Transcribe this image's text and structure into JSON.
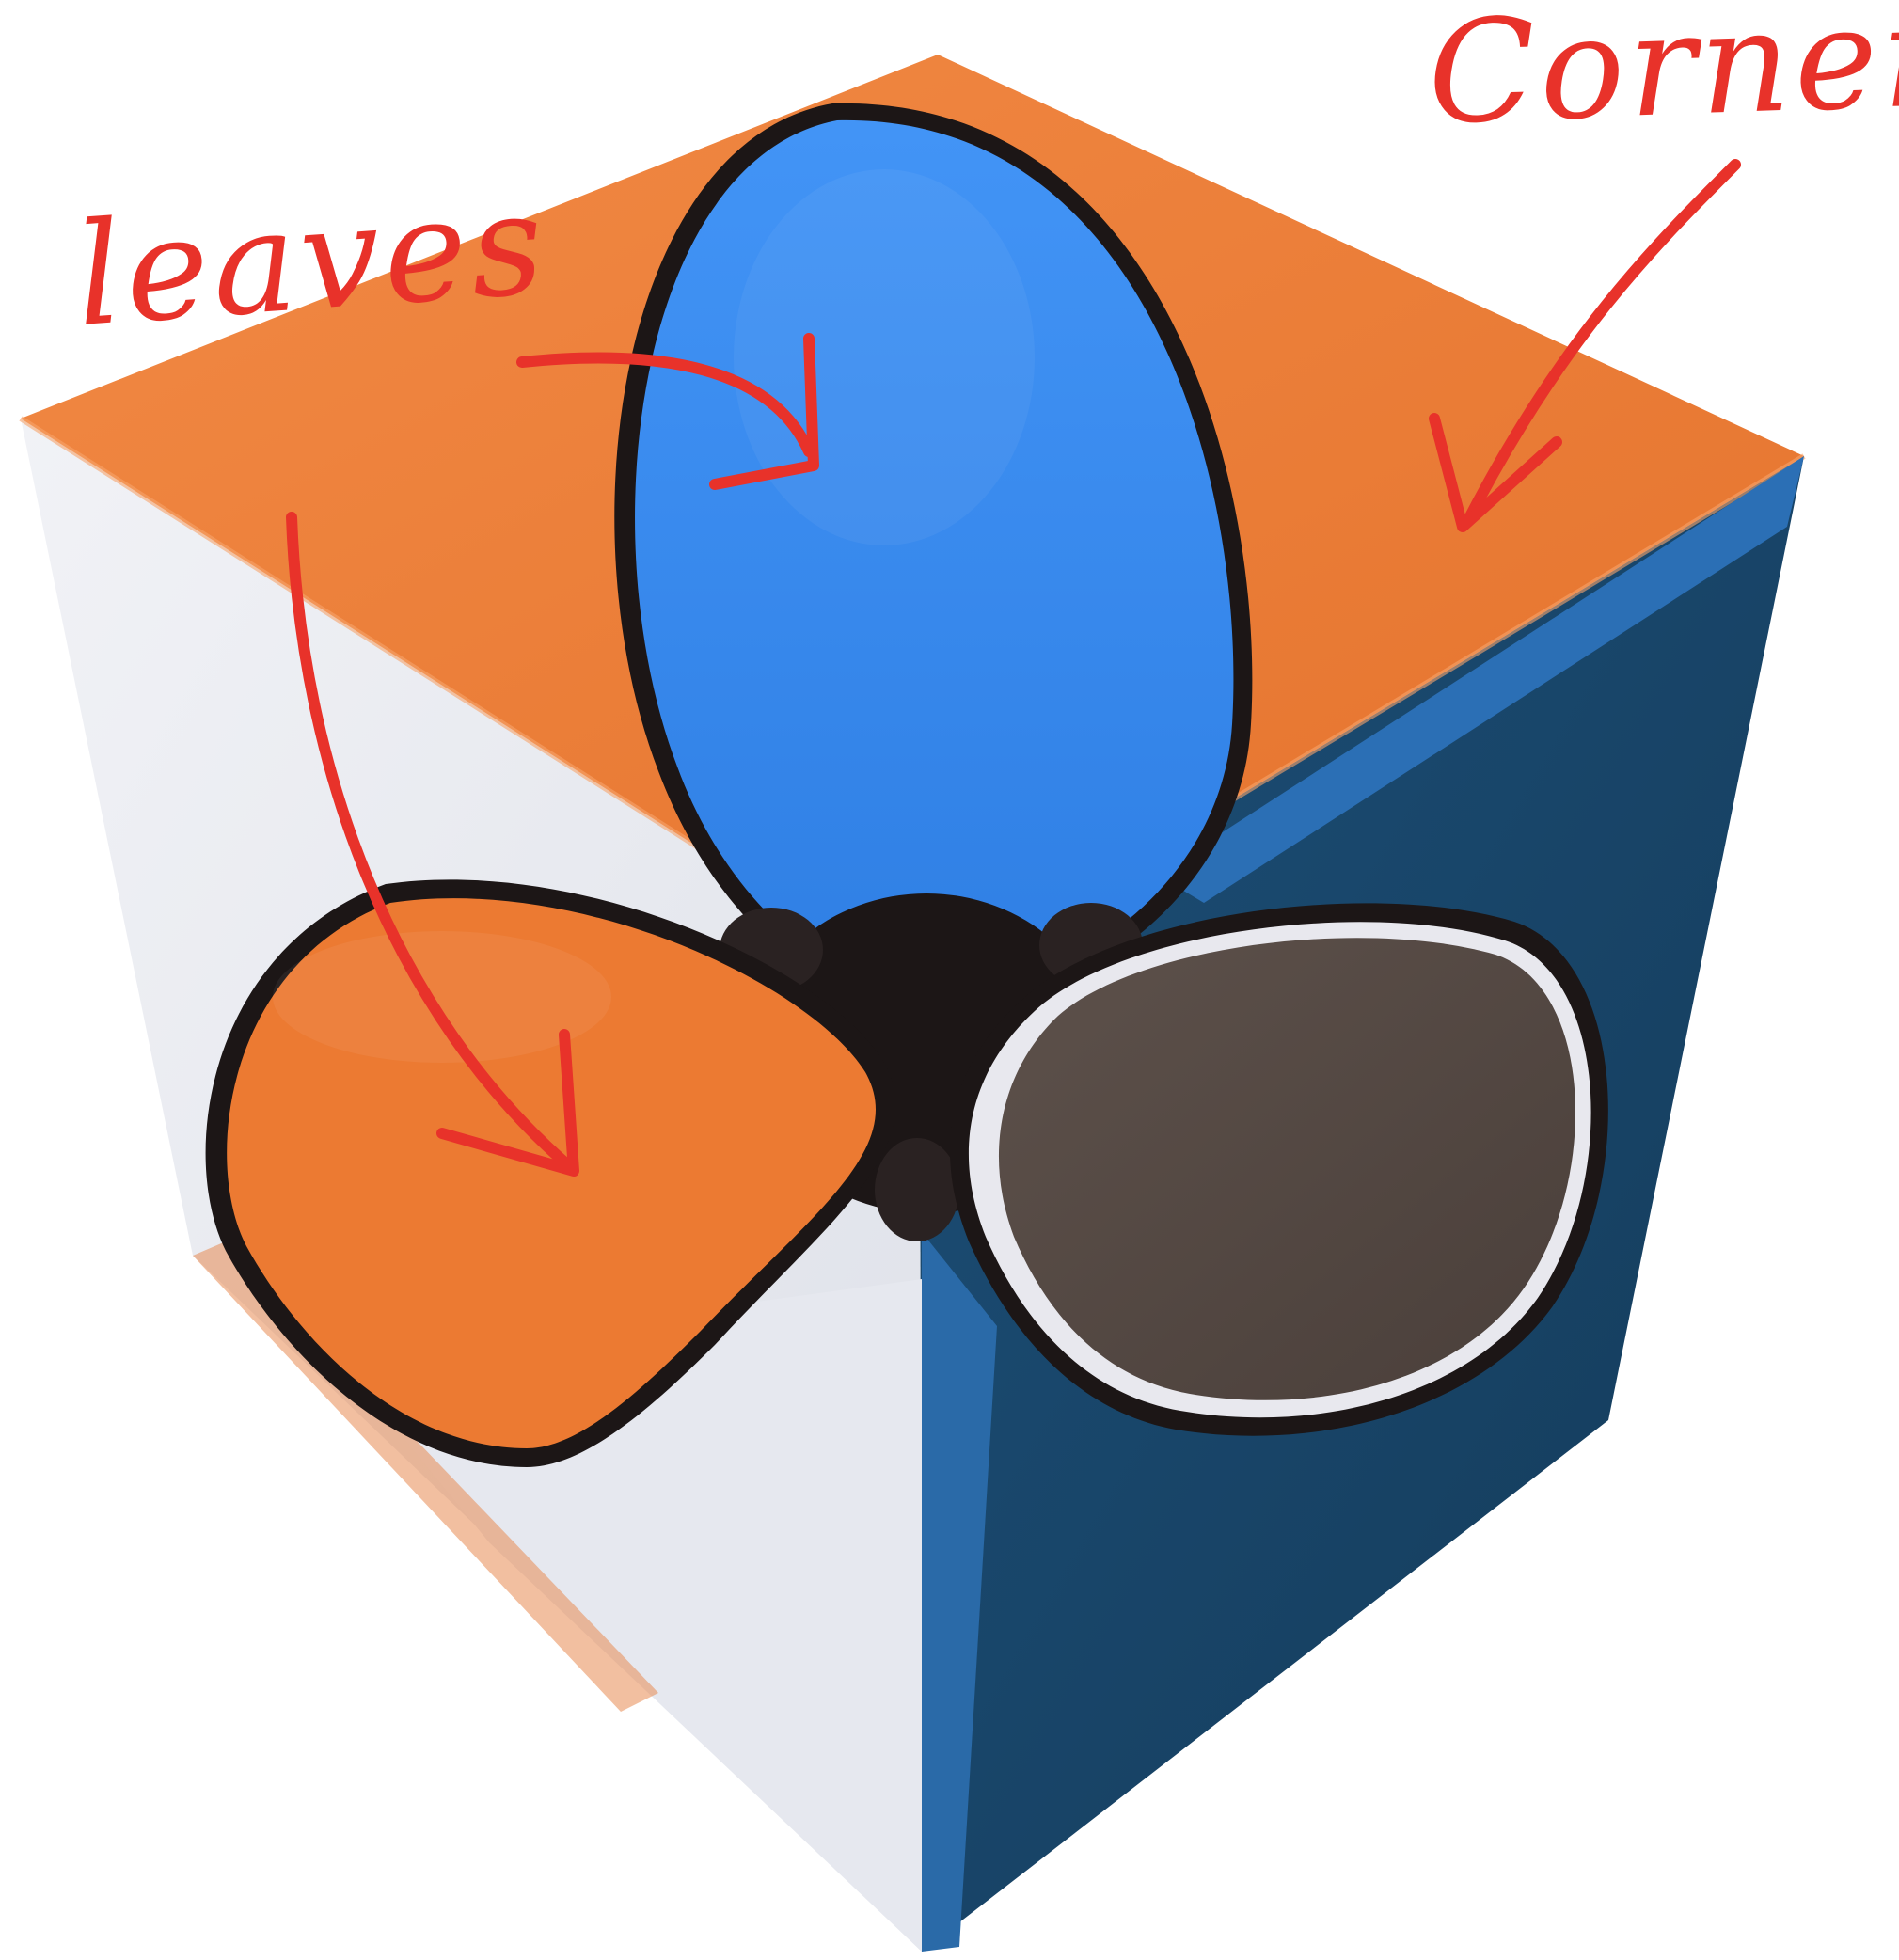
{
  "annotations": {
    "leaves_label": "leaves",
    "corner_label": "Corner"
  },
  "colors": {
    "background": "#ffffff",
    "orange": "#ee7d35",
    "orange_dark": "#e06f28",
    "blue_leaf": "#3a8cf0",
    "blue_face": "#1f5f8e",
    "blue_dark": "#173f5f",
    "white_face": "#eceef4",
    "white_shade": "#d4d7df",
    "brown_leaf": "#534742",
    "gap": "#1c1616",
    "annotation_red": "#e8322a"
  },
  "icons": [
    "arrow-to-top-leaf-icon",
    "arrow-to-front-leaf-icon",
    "arrow-to-corner-icon"
  ]
}
